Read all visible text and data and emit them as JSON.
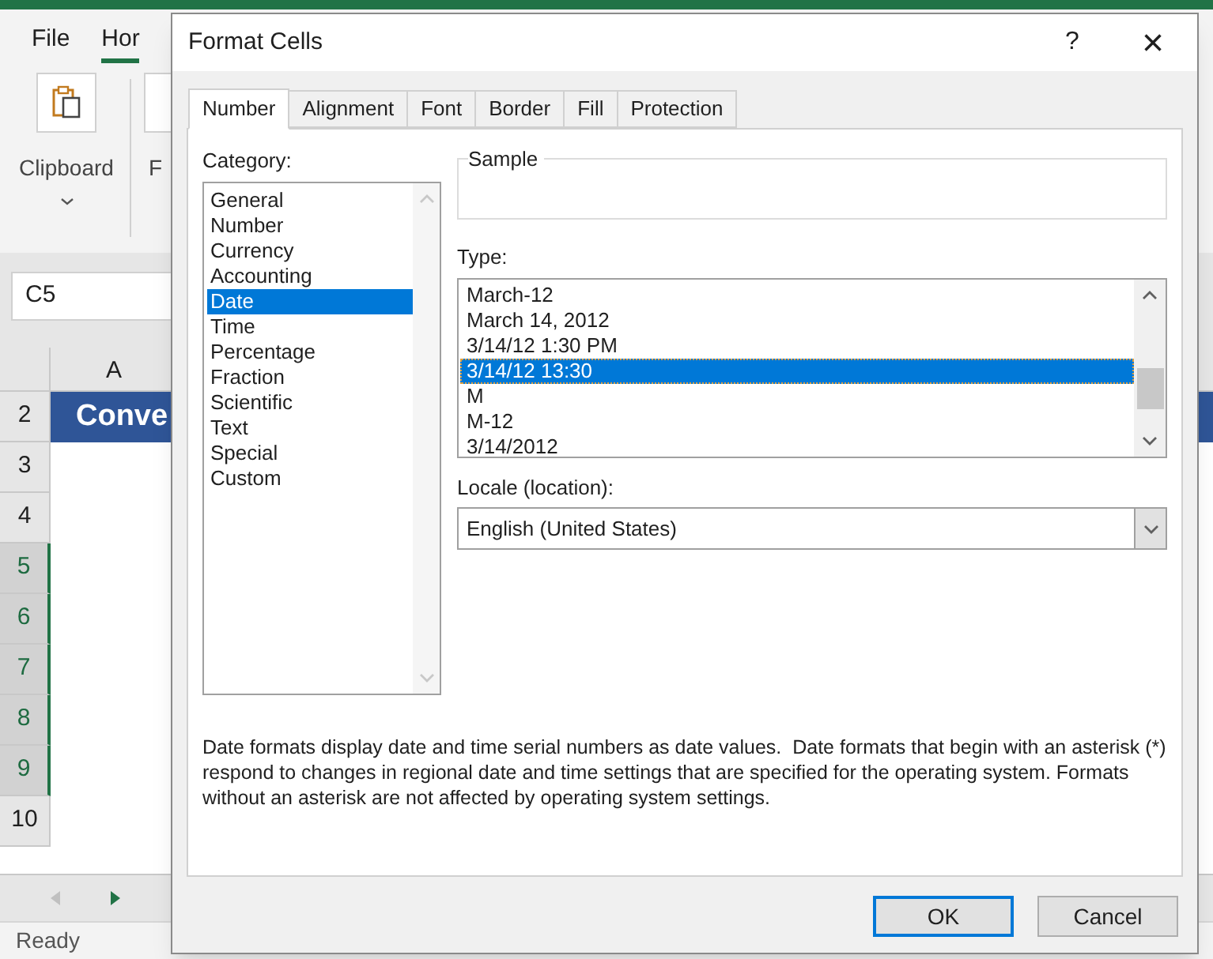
{
  "excel": {
    "ribbon_tabs": [
      {
        "label": "File",
        "selected": false
      },
      {
        "label": "Hor",
        "selected": true
      }
    ],
    "clipboard_label": "Clipboard",
    "partial_button_label": "F",
    "name_box": "C5",
    "column_header": "A",
    "rows": [
      {
        "number": "2",
        "cell": "Conve",
        "selected": false
      },
      {
        "number": "3",
        "cell": "",
        "selected": false
      },
      {
        "number": "4",
        "cell": "",
        "selected": false
      },
      {
        "number": "5",
        "cell": "",
        "selected": true
      },
      {
        "number": "6",
        "cell": "",
        "selected": true
      },
      {
        "number": "7",
        "cell": "",
        "selected": true
      },
      {
        "number": "8",
        "cell": "",
        "selected": true
      },
      {
        "number": "9",
        "cell": "",
        "selected": true
      },
      {
        "number": "10",
        "cell": "",
        "selected": false
      }
    ],
    "status": "Ready"
  },
  "dialog": {
    "title": "Format Cells",
    "help": "?",
    "close": "×",
    "tabs": [
      {
        "label": "Number",
        "selected": true
      },
      {
        "label": "Alignment",
        "selected": false
      },
      {
        "label": "Font",
        "selected": false
      },
      {
        "label": "Border",
        "selected": false
      },
      {
        "label": "Fill",
        "selected": false
      },
      {
        "label": "Protection",
        "selected": false
      }
    ],
    "category_label": "Category:",
    "categories": [
      {
        "label": "General",
        "selected": false
      },
      {
        "label": "Number",
        "selected": false
      },
      {
        "label": "Currency",
        "selected": false
      },
      {
        "label": "Accounting",
        "selected": false
      },
      {
        "label": "Date",
        "selected": true
      },
      {
        "label": "Time",
        "selected": false
      },
      {
        "label": "Percentage",
        "selected": false
      },
      {
        "label": "Fraction",
        "selected": false
      },
      {
        "label": "Scientific",
        "selected": false
      },
      {
        "label": "Text",
        "selected": false
      },
      {
        "label": "Special",
        "selected": false
      },
      {
        "label": "Custom",
        "selected": false
      }
    ],
    "sample_label": "Sample",
    "type_label": "Type:",
    "types": [
      {
        "label": "March-12",
        "selected": false
      },
      {
        "label": "March 14, 2012",
        "selected": false
      },
      {
        "label": "3/14/12 1:30 PM",
        "selected": false
      },
      {
        "label": "3/14/12 13:30",
        "selected": true
      },
      {
        "label": "M",
        "selected": false
      },
      {
        "label": "M-12",
        "selected": false
      },
      {
        "label": "3/14/2012",
        "selected": false
      }
    ],
    "locale_label": "Locale (location):",
    "locale_value": "English (United States)",
    "description": "Date formats display date and time serial numbers as date values.  Date formats that begin with an asterisk (*) respond to changes in regional date and time settings that are specified for the operating system. Formats without an asterisk are not affected by operating system settings.",
    "buttons": [
      {
        "label": "OK",
        "default": true
      },
      {
        "label": "Cancel",
        "default": false
      }
    ]
  }
}
